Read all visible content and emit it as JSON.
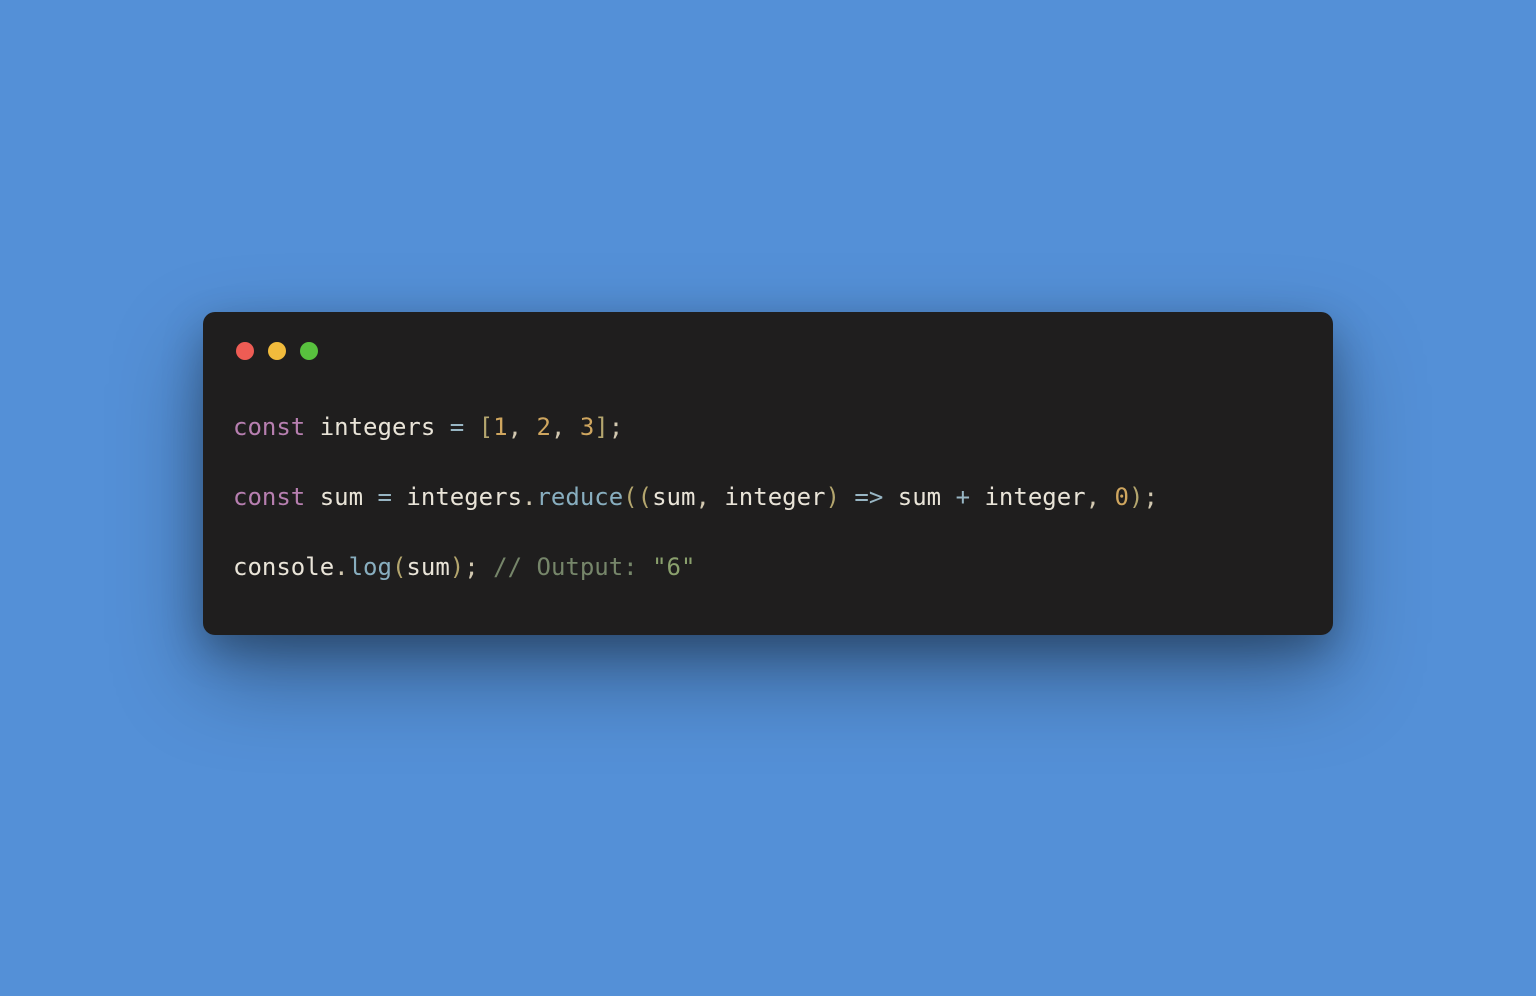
{
  "colors": {
    "background": "#5490d7",
    "window": "#1f1e1e",
    "dot_red": "#ee5c54",
    "dot_yellow": "#f1bb3c",
    "dot_green": "#58c13e"
  },
  "code": {
    "line1": {
      "kw1": "const",
      "sp1": " ",
      "ident1": "integers",
      "sp2": " ",
      "op1": "=",
      "sp3": " ",
      "br_open": "[",
      "n1": "1",
      "c1": ",",
      "sp4": " ",
      "n2": "2",
      "c2": ",",
      "sp5": " ",
      "n3": "3",
      "br_close": "]",
      "semi": ";"
    },
    "line3": {
      "kw1": "const",
      "sp1": " ",
      "ident1": "sum",
      "sp2": " ",
      "op1": "=",
      "sp3": " ",
      "ident2": "integers",
      "dot1": ".",
      "method1": "reduce",
      "p_open1": "(",
      "p_open2": "(",
      "param1": "sum",
      "c1": ",",
      "sp4": " ",
      "param2": "integer",
      "p_close1": ")",
      "sp5": " ",
      "arrow": "=>",
      "sp6": " ",
      "expr1": "sum",
      "sp7": " ",
      "plus": "+",
      "sp8": " ",
      "expr2": "integer",
      "c2": ",",
      "sp9": " ",
      "n1": "0",
      "p_close2": ")",
      "semi": ";"
    },
    "line5": {
      "ident1": "console",
      "dot1": ".",
      "method1": "log",
      "p_open1": "(",
      "arg1": "sum",
      "p_close1": ")",
      "semi": ";",
      "sp1": " ",
      "comment_prefix": "// Output: ",
      "comment_string": "\"6\""
    }
  }
}
